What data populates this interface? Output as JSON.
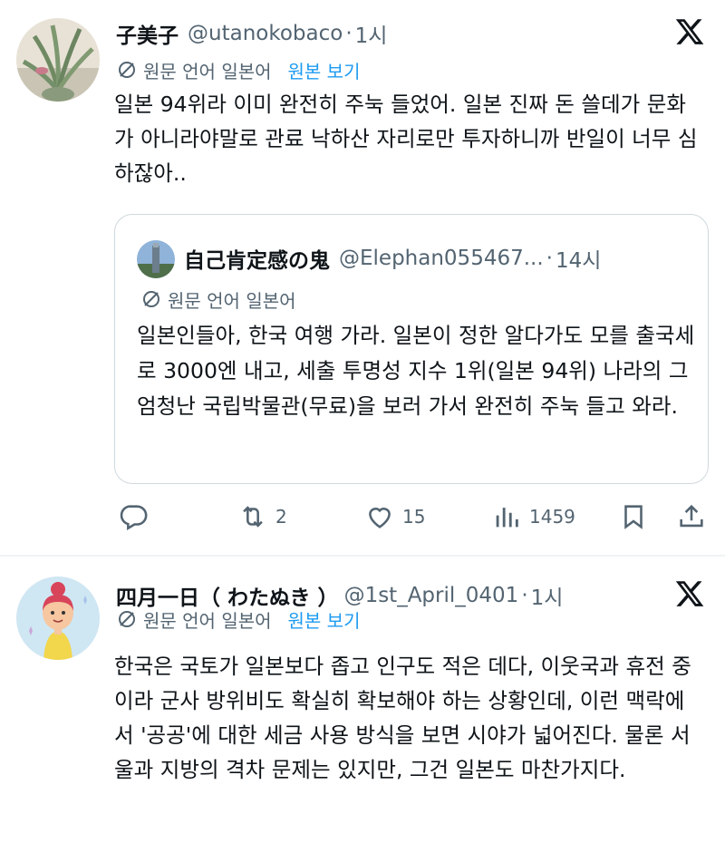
{
  "post1": {
    "display_name": "子美子",
    "handle": "@utanokobaco",
    "time": "1시",
    "lang_note": "원문 언어 일본어",
    "view_original": "원본 보기",
    "text": "일본 94위라 이미 완전히 주눅 들었어. 일본 진짜 돈 쓸데가 문화가 아니라야말로 관료 낙하산 자리로만 투자하니까 반일이 너무 심하잖아..",
    "quote": {
      "display_name": "自己肯定感の鬼",
      "handle": "@Elephan055467...",
      "time": "14시",
      "lang_note": "원문 언어 일본어",
      "text": "일본인들아, 한국 여행 가라. 일본이 정한 알다가도 모를 출국세로 3000엔 내고, 세출 투명성 지수 1위(일본 94위) 나라의 그 엄청난 국립박물관(무료)을 보러 가서 완전히 주눅 들고 와라."
    },
    "actions": {
      "retweets": "2",
      "likes": "15",
      "views": "1459"
    }
  },
  "post2": {
    "display_name": "四月一日（ わたぬき ）",
    "handle": "@1st_April_0401",
    "time": "1시",
    "lang_note": "원문 언어 일본어",
    "view_original": "원본 보기",
    "text": "한국은 국토가 일본보다 좁고 인구도 적은 데다, 이웃국과 휴전 중이라 군사 방위비도 확실히 확보해야 하는 상황인데, 이런 맥락에서 '공공'에 대한 세금 사용 방식을 보면 시야가 넓어진다. 물론 서울과 지방의 격차 문제는 있지만, 그건 일본도 마찬가지다."
  },
  "icons": {
    "translate": "translate-icon",
    "x_logo": "x-logo-icon",
    "reply": "reply-icon",
    "retweet": "retweet-icon",
    "like": "heart-icon",
    "views": "views-chart-icon",
    "bookmark": "bookmark-icon",
    "share": "share-icon"
  },
  "colors": {
    "link": "#1d9bf0",
    "secondary_text": "#536471",
    "border": "#cfd9de"
  }
}
